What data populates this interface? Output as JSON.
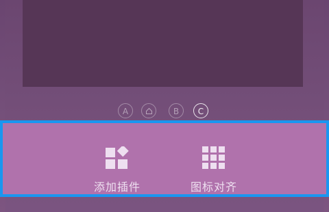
{
  "pager": {
    "pages": [
      {
        "id": "A",
        "label": "A"
      },
      {
        "id": "home",
        "label": ""
      },
      {
        "id": "B",
        "label": "B"
      },
      {
        "id": "C",
        "label": "C"
      }
    ],
    "active": "C"
  },
  "bottom_bar": {
    "add_widget_label": "添加插件",
    "align_icons_label": "图标对齐"
  },
  "colors": {
    "highlight_border": "#1a96f0",
    "bar_background": "#b072ac",
    "preview": "#563656"
  }
}
